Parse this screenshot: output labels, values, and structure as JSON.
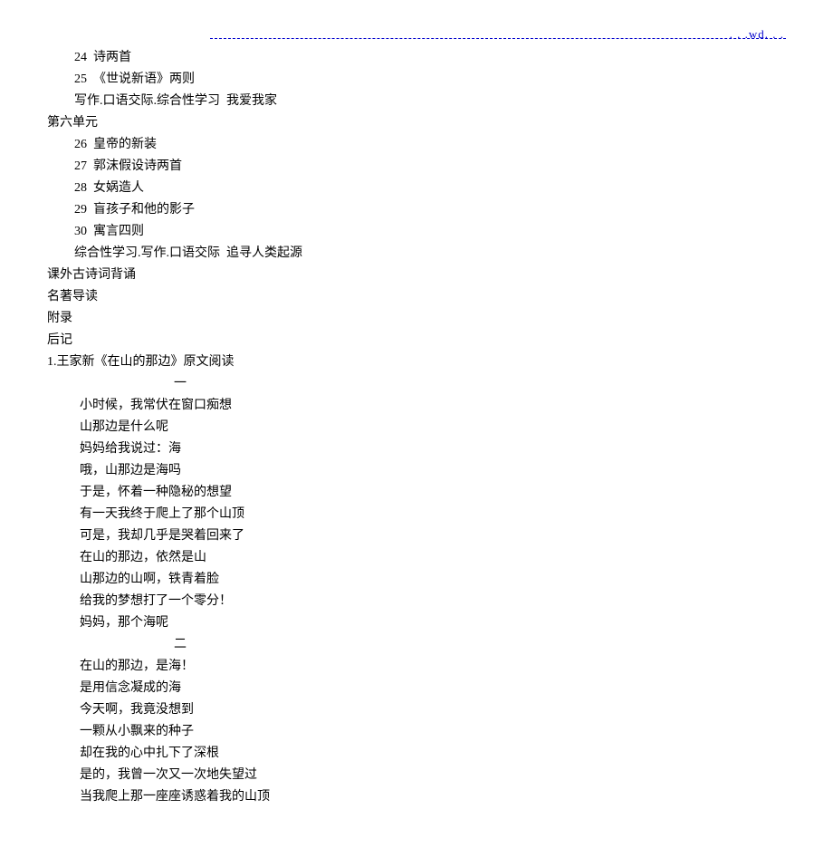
{
  "header": {
    "marker": ". . .wd. . ."
  },
  "toc": {
    "items24": "24  诗两首",
    "items25": "25  《世说新语》两则",
    "items_writing1": "写作.口语交际.综合性学习  我爱我家",
    "unit6": "第六单元",
    "items26": "26  皇帝的新装",
    "items27": "27  郭沫假设诗两首",
    "items28": "28  女娲造人",
    "items29": "29  盲孩子和他的影子",
    "items30": "30  寓言四则",
    "items_writing2": "综合性学习.写作.口语交际  追寻人类起源",
    "extra1": "课外古诗词背诵",
    "extra2": "名著导读",
    "extra3": "附录",
    "extra4": "后记"
  },
  "article": {
    "title": "1.王家新《在山的那边》原文阅读",
    "section1": "一",
    "lines1": [
      "小时候，我常伏在窗口痴想",
      "山那边是什么呢",
      "妈妈给我说过：海",
      "哦，山那边是海吗",
      "于是，怀着一种隐秘的想望",
      "有一天我终于爬上了那个山顶",
      "可是，我却几乎是哭着回来了",
      "在山的那边，依然是山",
      "山那边的山啊，铁青着脸",
      "给我的梦想打了一个零分！",
      "妈妈，那个海呢"
    ],
    "section2": "二",
    "lines2": [
      "在山的那边，是海！",
      "是用信念凝成的海",
      "今天啊，我竟没想到",
      "一颗从小飘来的种子",
      "却在我的心中扎下了深根",
      "是的，我曾一次又一次地失望过",
      "当我爬上那一座座诱惑着我的山顶"
    ]
  }
}
